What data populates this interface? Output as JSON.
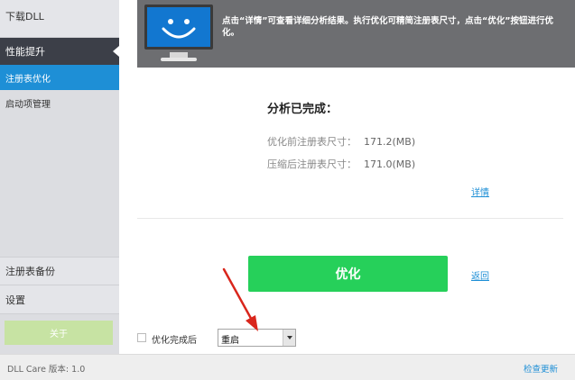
{
  "sidebar": {
    "items": [
      {
        "label": "下载DLL"
      },
      {
        "label": "性能提升"
      },
      {
        "label": "注册表优化"
      },
      {
        "label": "启动项管理"
      },
      {
        "label": "注册表备份"
      },
      {
        "label": "设置"
      }
    ],
    "about_label": "关于"
  },
  "banner": {
    "message": "点击“详情”可查看详细分析结果。执行优化可精简注册表尺寸，点击“优化”按钮进行优化。"
  },
  "main": {
    "status_title": "分析已完成：",
    "before_label": "优化前注册表尺寸：",
    "before_value": "171.2(MB)",
    "after_label": "压缩后注册表尺寸：",
    "after_value": "171.0(MB)",
    "details_link": "详情",
    "optimize_button": "优化",
    "back_link": "返回",
    "after_complete_label": "优化完成后",
    "after_complete_select": "重启"
  },
  "footer": {
    "version": "DLL Care 版本: 1.0",
    "check_update": "检查更新"
  },
  "colors": {
    "accent_blue": "#1e8fd6",
    "sidebar_dark": "#3c3f48",
    "optimize_green": "#26d05a",
    "annotation_red": "#d9261c"
  }
}
